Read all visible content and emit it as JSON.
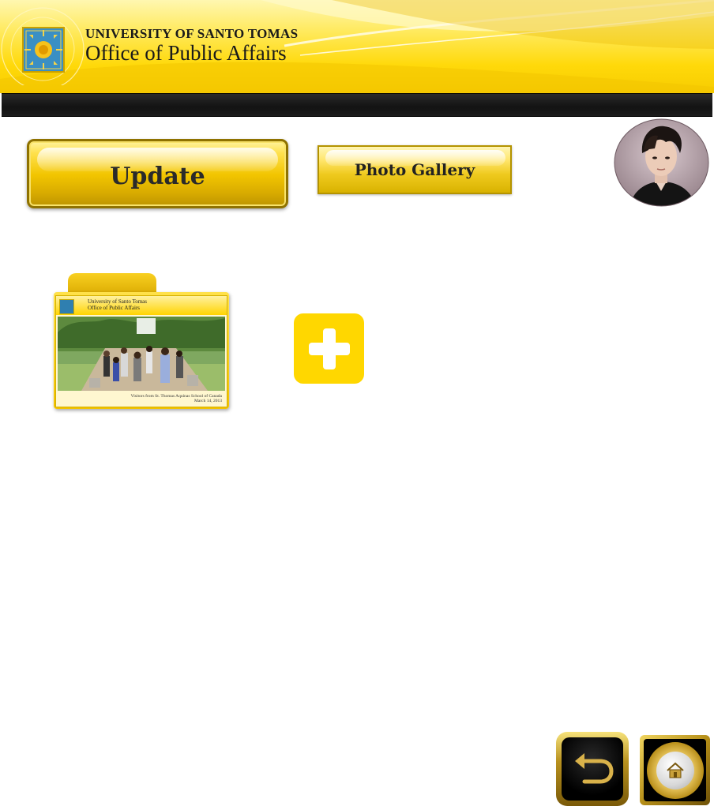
{
  "header": {
    "university": "UNIVERSITY OF SANTO TOMAS",
    "office": "Office of Public Affairs",
    "seal_icon": "ust-seal-logo",
    "brand_color": "#FFD700"
  },
  "toolbar": {
    "update_label": "Update",
    "gallery_label": "Photo Gallery"
  },
  "profile": {
    "avatar_icon": "user-avatar-photo"
  },
  "gallery": {
    "albums": [
      {
        "header_line1": "University of Santo Tomas",
        "header_line2": "Office of Public Affairs",
        "caption_line1": "Visitors from St. Thomas Aquinas School of Canada",
        "caption_line2": "March 14, 2013"
      }
    ],
    "add_icon": "plus-icon"
  },
  "nav": {
    "back_icon": "back-arrow-icon",
    "home_icon": "home-icon"
  }
}
